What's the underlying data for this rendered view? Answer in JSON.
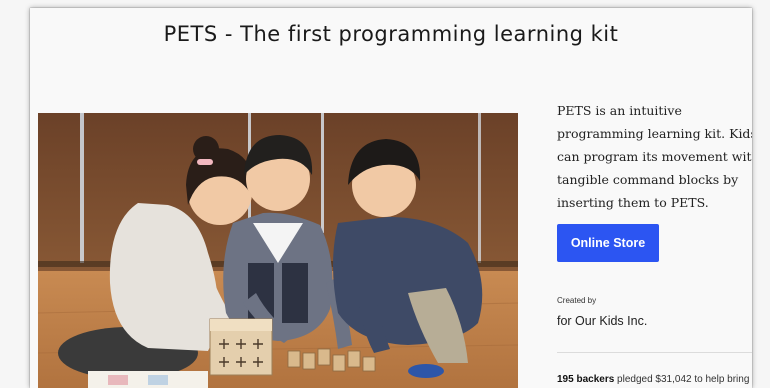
{
  "header": {
    "title": "PETS - The first programming learning kit"
  },
  "hero_image": {
    "alt": "children-playing-with-PETS-kit-photo"
  },
  "sidebar": {
    "description": "PETS is an intuitive programming learning kit. Kids can program its movement with tangible command blocks by inserting them to PETS.",
    "store_button_label": "Online Store",
    "created_by_label": "Created by",
    "creator_name": "for Our Kids Inc.",
    "backers_count": "195 backers",
    "pledge_text": " pledged $31,042 to help bring"
  },
  "colors": {
    "accent": "#2c55f2",
    "background": "#f9f9f9",
    "text": "#222222"
  }
}
